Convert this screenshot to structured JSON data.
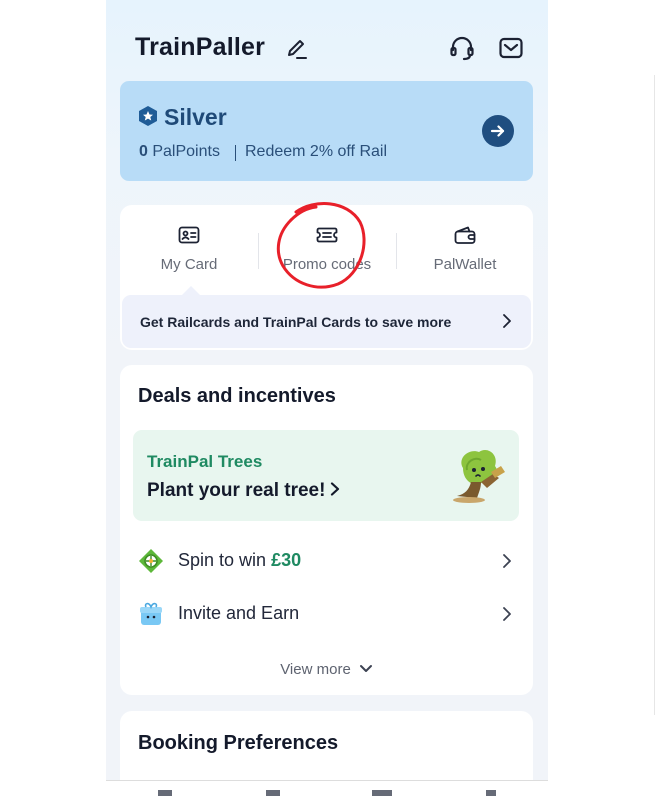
{
  "header": {
    "title": "TrainPaller"
  },
  "tier": {
    "name": "Silver",
    "points_value": "0",
    "points_unit": "PalPoints",
    "redeem_text": "Redeem 2% off Rail"
  },
  "shortcuts": {
    "my_card": "My Card",
    "promo_codes": "Promo codes",
    "palwallet": "PalWallet"
  },
  "railcard_banner": {
    "text": "Get Railcards and TrainPal Cards to save more"
  },
  "deals": {
    "title": "Deals and incentives",
    "trees": {
      "title": "TrainPal Trees",
      "subtitle": "Plant your real tree!"
    },
    "spin": {
      "label": "Spin to win ",
      "amount": "£30"
    },
    "invite": {
      "label": "Invite and Earn"
    },
    "view_more": "View more"
  },
  "booking": {
    "title": "Booking Preferences"
  },
  "colors": {
    "tier_bg": "#b8dcf7",
    "tier_text": "#1f4a78",
    "accent_green": "#1f8a62",
    "annotation_red": "#e8202a"
  }
}
